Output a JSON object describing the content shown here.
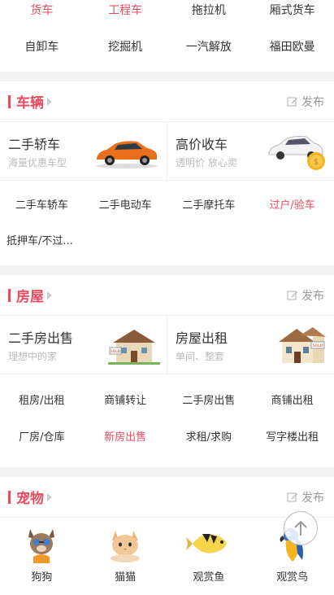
{
  "top_links": {
    "row1": [
      "货车",
      "工程车",
      "拖拉机",
      "厢式货车"
    ],
    "row2": [
      "自卸车",
      "挖掘机",
      "一汽解放",
      "福田欧曼"
    ]
  },
  "vehicles": {
    "title": "车辆",
    "publish": "发布",
    "featured": [
      {
        "title": "二手轿车",
        "sub": "海量优惠车型"
      },
      {
        "title": "高价收车",
        "sub": "透明价 放心卖"
      }
    ],
    "links_row1": [
      "二手车轿车",
      "二手电动车",
      "二手摩托车",
      "过户/验车"
    ],
    "links_row2": "抵押车/不过..."
  },
  "housing": {
    "title": "房屋",
    "publish": "发布",
    "featured": [
      {
        "title": "二手房出售",
        "sub": "理想中的家"
      },
      {
        "title": "房屋出租",
        "sub": "单间、整套"
      }
    ],
    "links_row1": [
      "租房/出租",
      "商铺转让",
      "二手房出售",
      "商铺出租"
    ],
    "links_row2": [
      "厂房/仓库",
      "新房出售",
      "求租/求购",
      "写字楼出租"
    ]
  },
  "pets": {
    "title": "宠物",
    "publish": "发布",
    "items": [
      "狗狗",
      "猫猫",
      "观赏鱼",
      "观赏鸟"
    ]
  },
  "colors": {
    "accent": "#e84b5f"
  },
  "icons": [
    "pencil-icon",
    "chevron-right-icon",
    "arrow-up-icon"
  ]
}
